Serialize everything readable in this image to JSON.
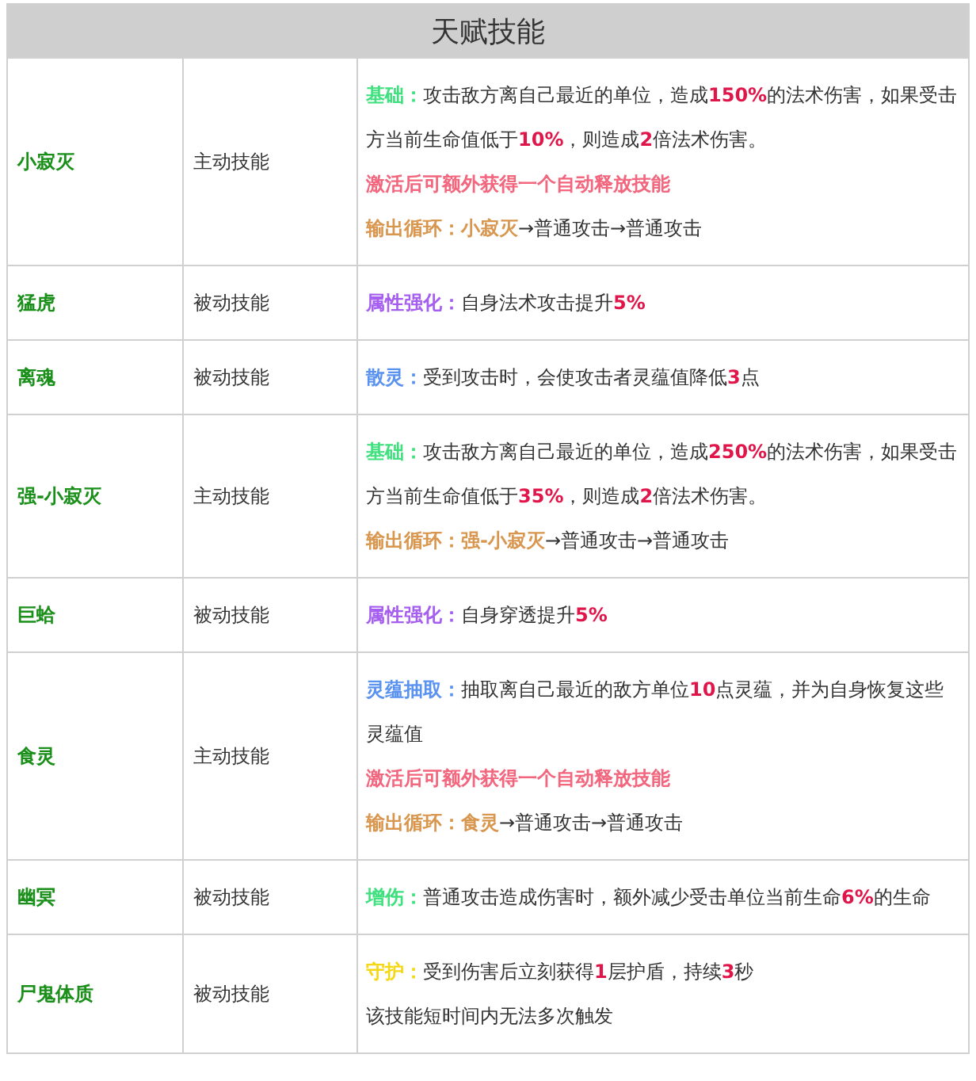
{
  "table": {
    "title": "天赋技能",
    "rows": [
      {
        "name": "小寂灭",
        "type": "主动技能",
        "lines": [
          [
            {
              "kind": "mark",
              "text": "基础：",
              "color": "#3fe07e"
            },
            {
              "kind": "plain",
              "text": "攻击敌方离自己最近的单位，造成"
            },
            {
              "kind": "mark",
              "text": "150%",
              "color": "#e0154a"
            },
            {
              "kind": "plain",
              "text": "的法术伤害，如果受击方当前生命值低于"
            },
            {
              "kind": "mark",
              "text": "10%",
              "color": "#e0154a"
            },
            {
              "kind": "plain",
              "text": "，则造成"
            },
            {
              "kind": "mark",
              "text": "2",
              "color": "#e0154a"
            },
            {
              "kind": "plain",
              "text": "倍法术伤害。"
            }
          ],
          [
            {
              "kind": "mark",
              "text": "激活后可额外获得一个自动释放技能",
              "color": "#f2667e"
            }
          ],
          [
            {
              "kind": "mark",
              "text": "输出循环：小寂灭",
              "color": "#d8964f"
            },
            {
              "kind": "plain",
              "text": "→普通攻击→普通攻击"
            }
          ]
        ]
      },
      {
        "name": "猛虎",
        "type": "被动技能",
        "lines": [
          [
            {
              "kind": "mark",
              "text": "属性强化：",
              "color": "#a55ef0"
            },
            {
              "kind": "plain",
              "text": "自身法术攻击提升"
            },
            {
              "kind": "mark",
              "text": "5%",
              "color": "#e0154a"
            }
          ]
        ]
      },
      {
        "name": "离魂",
        "type": "被动技能",
        "lines": [
          [
            {
              "kind": "mark",
              "text": "散灵：",
              "color": "#5a92f0"
            },
            {
              "kind": "plain",
              "text": "受到攻击时，会使攻击者灵蕴值降低"
            },
            {
              "kind": "mark",
              "text": "3",
              "color": "#e0154a"
            },
            {
              "kind": "plain",
              "text": "点"
            }
          ]
        ]
      },
      {
        "name": "强-小寂灭",
        "type": "主动技能",
        "lines": [
          [
            {
              "kind": "mark",
              "text": "基础：",
              "color": "#3fe07e"
            },
            {
              "kind": "plain",
              "text": "攻击敌方离自己最近的单位，造成"
            },
            {
              "kind": "mark",
              "text": "250%",
              "color": "#e0154a"
            },
            {
              "kind": "plain",
              "text": "的法术伤害，如果受击方当前生命值低于"
            },
            {
              "kind": "mark",
              "text": "35%",
              "color": "#e0154a"
            },
            {
              "kind": "plain",
              "text": "，则造成"
            },
            {
              "kind": "mark",
              "text": "2",
              "color": "#e0154a"
            },
            {
              "kind": "plain",
              "text": "倍法术伤害。"
            }
          ],
          [
            {
              "kind": "mark",
              "text": "输出循环：强-小寂灭",
              "color": "#d8964f"
            },
            {
              "kind": "plain",
              "text": "→普通攻击→普通攻击"
            }
          ]
        ]
      },
      {
        "name": "巨蛤",
        "type": "被动技能",
        "lines": [
          [
            {
              "kind": "mark",
              "text": "属性强化：",
              "color": "#a55ef0"
            },
            {
              "kind": "plain",
              "text": "自身穿透提升"
            },
            {
              "kind": "mark",
              "text": "5%",
              "color": "#e0154a"
            }
          ]
        ]
      },
      {
        "name": "食灵",
        "type": "主动技能",
        "lines": [
          [
            {
              "kind": "mark",
              "text": "灵蕴抽取：",
              "color": "#5a92f0"
            },
            {
              "kind": "plain",
              "text": "抽取离自己最近的敌方单位"
            },
            {
              "kind": "mark",
              "text": "10",
              "color": "#e0154a"
            },
            {
              "kind": "plain",
              "text": "点灵蕴，并为自身恢复这些灵蕴值"
            }
          ],
          [
            {
              "kind": "mark",
              "text": "激活后可额外获得一个自动释放技能",
              "color": "#f2667e"
            }
          ],
          [
            {
              "kind": "mark",
              "text": "输出循环：食灵",
              "color": "#d8964f"
            },
            {
              "kind": "plain",
              "text": "→普通攻击→普通攻击"
            }
          ]
        ]
      },
      {
        "name": "幽冥",
        "type": "被动技能",
        "lines": [
          [
            {
              "kind": "mark",
              "text": "增伤：",
              "color": "#3fe07e"
            },
            {
              "kind": "plain",
              "text": "普通攻击造成伤害时，额外减少受击单位当前生命"
            },
            {
              "kind": "mark",
              "text": "6%",
              "color": "#e0154a"
            },
            {
              "kind": "plain",
              "text": "的生命"
            }
          ]
        ]
      },
      {
        "name": "尸鬼体质",
        "type": "被动技能",
        "lines": [
          [
            {
              "kind": "mark",
              "text": "守护：",
              "color": "#f5d815"
            },
            {
              "kind": "plain",
              "text": "受到伤害后立刻获得"
            },
            {
              "kind": "mark",
              "text": "1",
              "color": "#e0154a"
            },
            {
              "kind": "plain",
              "text": "层护盾，持续"
            },
            {
              "kind": "mark",
              "text": "3",
              "color": "#e0154a"
            },
            {
              "kind": "plain",
              "text": "秒"
            }
          ],
          [
            {
              "kind": "plain",
              "text": "该技能短时间内无法多次触发"
            }
          ]
        ]
      }
    ]
  }
}
